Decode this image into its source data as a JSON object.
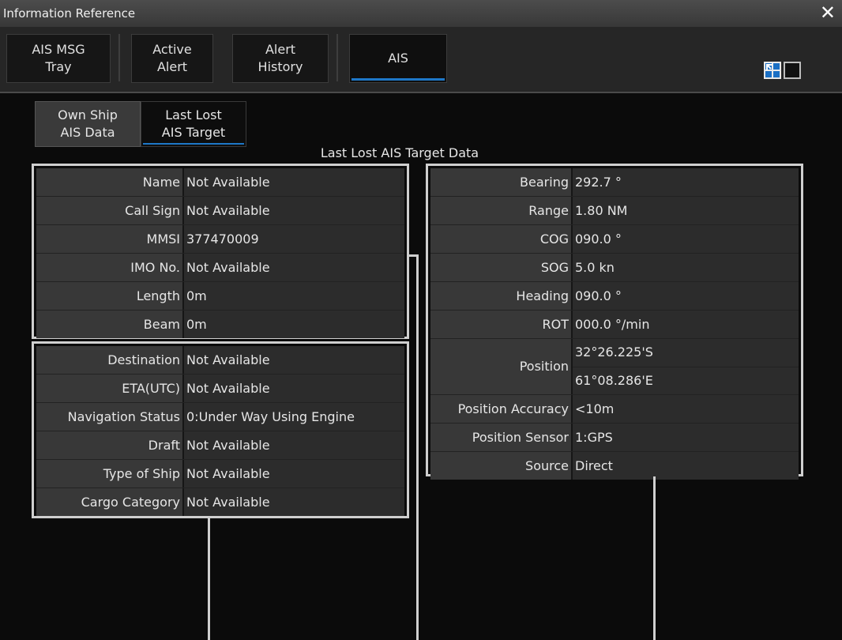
{
  "window": {
    "title": "Information Reference",
    "close_glyph": "✕"
  },
  "tabs": [
    {
      "line1": "AIS MSG",
      "line2": "Tray"
    },
    {
      "line1": "Active",
      "line2": "Alert"
    },
    {
      "line1": "Alert",
      "line2": "History"
    },
    {
      "line1": "AIS",
      "line2": ""
    }
  ],
  "subtabs": [
    {
      "line1": "Own Ship",
      "line2": "AIS Data"
    },
    {
      "line1": "Last Lost",
      "line2": "AIS Target"
    }
  ],
  "section_title": "Last Lost AIS Target Data",
  "static_info": [
    {
      "label": "Name",
      "value": "Not Available"
    },
    {
      "label": "Call Sign",
      "value": "Not Available"
    },
    {
      "label": "MMSI",
      "value": "377470009"
    },
    {
      "label": "IMO No.",
      "value": "Not Available"
    },
    {
      "label": "Length",
      "value": "0m"
    },
    {
      "label": "Beam",
      "value": "0m"
    }
  ],
  "voyage_info": [
    {
      "label": "Destination",
      "value": "Not Available"
    },
    {
      "label": "ETA(UTC)",
      "value": "Not Available"
    },
    {
      "label": "Navigation Status",
      "value": "0:Under Way Using Engine"
    },
    {
      "label": "Draft",
      "value": "Not Available"
    },
    {
      "label": "Type of Ship",
      "value": "Not Available"
    },
    {
      "label": "Cargo Category",
      "value": "Not Available"
    }
  ],
  "dynamic_info": [
    {
      "label": "Bearing",
      "value": "292.7 °"
    },
    {
      "label": "Range",
      "value": "1.80 NM"
    },
    {
      "label": "COG",
      "value": "090.0 °"
    },
    {
      "label": "SOG",
      "value": "5.0 kn"
    },
    {
      "label": "Heading",
      "value": "090.0 °"
    },
    {
      "label": "ROT",
      "value": "000.0 °/min"
    }
  ],
  "position": {
    "label": "Position",
    "lat": "32°26.225'S",
    "lon": "61°08.286'E"
  },
  "dynamic_info_2": [
    {
      "label": "Position Accuracy",
      "value": "<10m"
    },
    {
      "label": "Position Sensor",
      "value": "1:GPS"
    },
    {
      "label": "Source",
      "value": "Direct"
    }
  ],
  "colors": {
    "accent": "#1e78c8",
    "frame": "#cfcfcf",
    "label_bg": "#383838",
    "value_bg": "#2c2c2c"
  },
  "icons": {
    "layout_split": "layout-split-icon",
    "layout_single": "layout-single-icon",
    "close": "close-icon"
  }
}
